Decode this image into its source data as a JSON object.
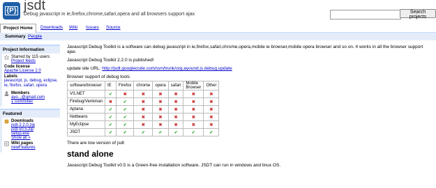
{
  "header": {
    "logo_text": "{P}",
    "project_name": "jsdt",
    "summary": "Debug javascript in ie,firefox,chrome,safari,opera and all browsers support ajax",
    "search_button": "Search projects"
  },
  "tabs": [
    "Project Home",
    "Downloads",
    "Wiki",
    "Issues",
    "Source"
  ],
  "subnav": {
    "active": "Summary",
    "link": "People"
  },
  "sidebar": {
    "info_title": "Project Information",
    "starred": "Starred by 115 users",
    "feeds": "Project feeds",
    "license_label": "Code license",
    "license": "Apache License 2.0",
    "labels_label": "Labels",
    "labels": "javascript, js, debug, eclipse, ie, firefox, safari, opera",
    "members_label": "Members",
    "member": "ayo...@gmail.com",
    "committer": "1 committer",
    "featured_title": "Featured",
    "downloads_label": "Downloads",
    "downloads": [
      "jsdt-2.2.0.zip",
      "jsdt-v0.5.zip",
      "setup.exe"
    ],
    "show_all": "Show all »",
    "wiki_label": "Wiki pages",
    "wiki": "newFeatures"
  },
  "main": {
    "intro": "Javascript Debug Toolkit is a software can debug javascript in ie,firefox,safari,chrome,opera,mobile ie browser,mobile opera browser and so on. It works in all the browser support ajax.",
    "published": "Javascript Debug Toolkit 2.2.0 is published!",
    "update_label": "update site URL:",
    "update_url": "http://jsdt.googlecode.com/svn/trunk/org.ayound.js.debug.update",
    "support_title": "Browser support of debug tools",
    "table_headers": [
      "software/browser",
      "IE",
      "Firefox",
      "chrome",
      "opera",
      "safari",
      "Mobile Browser",
      "Other"
    ],
    "table_rows": [
      {
        "name": "VS.NET",
        "marks": [
          1,
          0,
          0,
          0,
          0,
          0,
          0
        ]
      },
      {
        "name": "Firebug/Venkman",
        "marks": [
          0,
          1,
          0,
          0,
          0,
          0,
          0
        ]
      },
      {
        "name": "Aptana",
        "marks": [
          1,
          1,
          0,
          0,
          0,
          0,
          0
        ]
      },
      {
        "name": "Netbeans",
        "marks": [
          1,
          1,
          0,
          0,
          0,
          0,
          0
        ]
      },
      {
        "name": "MyEclipse",
        "marks": [
          1,
          1,
          0,
          0,
          0,
          0,
          0
        ]
      },
      {
        "name": "JSDT",
        "marks": [
          1,
          1,
          1,
          1,
          1,
          1,
          1
        ]
      }
    ],
    "versions_note": "There are tow version of jsdt",
    "stand_alone": "stand alone",
    "cutoff_line": "Javascript Debug Toolkit v0.5 is a Green-free installation software. JSDT can run in windows and linux OS."
  },
  "colors": {
    "accent": "#c3d9ff",
    "panel": "#e5ecf9",
    "ok": "#33aa33",
    "no": "#cc3333"
  }
}
